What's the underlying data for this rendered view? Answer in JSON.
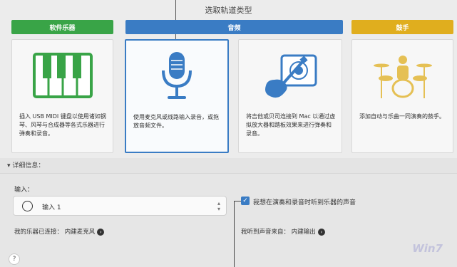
{
  "dialog": {
    "title": "选取轨道类型"
  },
  "categories": [
    {
      "label": "软件乐器",
      "color": "#39a447"
    },
    {
      "label": "音频",
      "color": "#3a7cc4"
    },
    {
      "label": "鼓手",
      "color": "#e0ae1e"
    }
  ],
  "cards": [
    {
      "icon": "piano-keyboard-icon",
      "desc": "插入 USB MIDI 键盘以使用诸如钢琴、风琴与合成器等各式乐器进行弹奏和录音。"
    },
    {
      "icon": "microphone-icon",
      "desc": "使用麦克风或线路输入录音，或拖放音频文件。"
    },
    {
      "icon": "guitar-amp-icon",
      "desc": "将吉他或贝司连接到 Mac 以通过虚拟放大器和踏板效果来进行弹奏和录音。"
    },
    {
      "icon": "drummer-icon",
      "desc": "添加自动与乐曲一同演奏的鼓手。"
    }
  ],
  "details": {
    "label": "▾ 详细信息："
  },
  "input": {
    "label": "输入：",
    "value": "输入 1",
    "connected": "我的乐器已连接：  内建麦克风"
  },
  "monitor": {
    "checkbox_label": "我想在演奏和录音时听到乐器的声音",
    "checked": true,
    "hear_from": "我听到声音来自：  内建输出"
  },
  "help": {
    "label": "?"
  },
  "watermark": "Win7"
}
